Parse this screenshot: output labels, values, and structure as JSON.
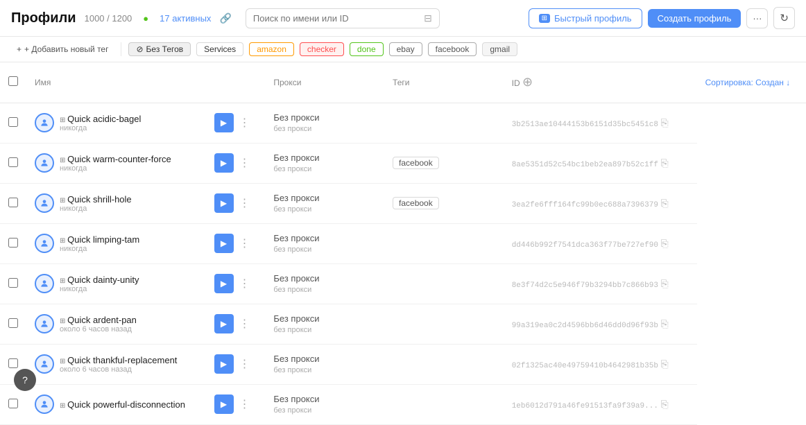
{
  "header": {
    "title": "Профили",
    "count": "1000 / 1200",
    "dot": "●",
    "active_label": "17 активных",
    "search_placeholder": "Поиск по имени или ID",
    "btn_quick": "Быстрый профиль",
    "btn_create": "Создать профиль",
    "btn_more": "···",
    "btn_refresh": "↻"
  },
  "tags_bar": {
    "add_label": "+ Добавить новый тег",
    "tags": [
      {
        "id": "no-tags",
        "label": "Без Тегов",
        "class": "no-tags",
        "has_icon": true
      },
      {
        "id": "services",
        "label": "Services",
        "class": ""
      },
      {
        "id": "amazon",
        "label": "amazon",
        "class": "amazon"
      },
      {
        "id": "checker",
        "label": "checker",
        "class": "checker"
      },
      {
        "id": "done",
        "label": "done",
        "class": "done"
      },
      {
        "id": "ebay",
        "label": "ebay",
        "class": "ebay"
      },
      {
        "id": "facebook",
        "label": "facebook",
        "class": "facebook-tag"
      },
      {
        "id": "gmail",
        "label": "gmail",
        "class": "gmail"
      }
    ]
  },
  "table": {
    "columns": [
      "Имя",
      "Сортировка: Создан ↓",
      "Прокси",
      "Теги",
      "ID"
    ],
    "sort_col": "Создан ↓",
    "rows": [
      {
        "id": 1,
        "name": "Quick acidic-bagel",
        "sub": "никогда",
        "proxy": "Без прокси",
        "proxy_sub": "без прокси",
        "tags": [],
        "hash": "3b2513ae10444153b6151d35bc5451c8"
      },
      {
        "id": 2,
        "name": "Quick warm-counter-force",
        "sub": "никогда",
        "proxy": "Без прокси",
        "proxy_sub": "без прокси",
        "tags": [
          "facebook"
        ],
        "hash": "8ae5351d52c54bc1beb2ea897b52c1ff"
      },
      {
        "id": 3,
        "name": "Quick shrill-hole",
        "sub": "никогда",
        "proxy": "Без прокси",
        "proxy_sub": "без прокси",
        "tags": [
          "facebook"
        ],
        "hash": "3ea2fe6fff164fc99b0ec688a7396379"
      },
      {
        "id": 4,
        "name": "Quick limping-tam",
        "sub": "никогда",
        "proxy": "Без прокси",
        "proxy_sub": "без прокси",
        "tags": [],
        "hash": "dd446b992f7541dca363f77be727ef90"
      },
      {
        "id": 5,
        "name": "Quick dainty-unity",
        "sub": "никогда",
        "proxy": "Без прокси",
        "proxy_sub": "без прокси",
        "tags": [],
        "hash": "8e3f74d2c5e946f79b3294bb7c866b93"
      },
      {
        "id": 6,
        "name": "Quick ardent-pan",
        "sub": "около 6 часов назад",
        "proxy": "Без прокси",
        "proxy_sub": "без прокси",
        "tags": [],
        "hash": "99a319ea0c2d4596bb6d46dd0d96f93b"
      },
      {
        "id": 7,
        "name": "Quick thankful-replacement",
        "sub": "около 6 часов назад",
        "proxy": "Без прокси",
        "proxy_sub": "без прокси",
        "tags": [],
        "hash": "02f1325ac40e49759410b4642981b35b"
      },
      {
        "id": 8,
        "name": "Quick powerful-disconnection",
        "sub": "",
        "proxy": "Без прокси",
        "proxy_sub": "без прокси",
        "tags": [],
        "hash": "1eb6012d791a46fe91513fa9f39a9..."
      }
    ]
  },
  "help": "?",
  "icons": {
    "pin": "📌",
    "search": "🔍",
    "filter": "⊟",
    "windows": "⊞",
    "play": "▶",
    "more": "⋮",
    "copy": "⎘",
    "add_row": "⊕",
    "no_tag_icon": "⊘",
    "plus": "+"
  }
}
